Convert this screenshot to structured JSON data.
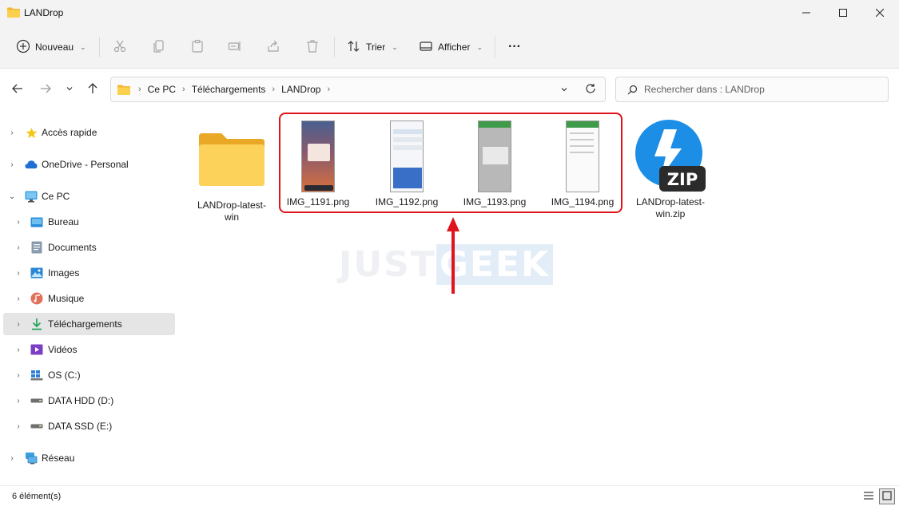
{
  "window": {
    "title": "LANDrop"
  },
  "toolbar": {
    "new_label": "Nouveau",
    "sort_label": "Trier",
    "view_label": "Afficher",
    "more_label": "···"
  },
  "address": {
    "crumbs": [
      "Ce PC",
      "Téléchargements",
      "LANDrop"
    ],
    "search_placeholder": "Rechercher dans : LANDrop"
  },
  "sidebar": {
    "items": [
      {
        "label": "Accès rapide",
        "icon": "star-icon"
      },
      {
        "label": "OneDrive - Personal",
        "icon": "cloud-icon"
      },
      {
        "label": "Ce PC",
        "icon": "monitor-icon"
      },
      {
        "label": "Bureau",
        "icon": "desktop-icon"
      },
      {
        "label": "Documents",
        "icon": "document-icon"
      },
      {
        "label": "Images",
        "icon": "image-icon"
      },
      {
        "label": "Musique",
        "icon": "music-icon"
      },
      {
        "label": "Téléchargements",
        "icon": "download-icon"
      },
      {
        "label": "Vidéos",
        "icon": "video-icon"
      },
      {
        "label": "OS (C:)",
        "icon": "windows-drive-icon"
      },
      {
        "label": "DATA HDD (D:)",
        "icon": "drive-icon"
      },
      {
        "label": "DATA SSD (E:)",
        "icon": "drive-icon"
      },
      {
        "label": "Réseau",
        "icon": "network-icon"
      }
    ]
  },
  "files": [
    {
      "name": "LANDrop-latest-win",
      "icon": "folder-icon"
    },
    {
      "name": "IMG_1191.png",
      "icon": "image-thumbnail"
    },
    {
      "name": "IMG_1192.png",
      "icon": "image-thumbnail"
    },
    {
      "name": "IMG_1193.png",
      "icon": "image-thumbnail"
    },
    {
      "name": "IMG_1194.png",
      "icon": "image-thumbnail"
    },
    {
      "name": "LANDrop-latest-win.zip",
      "icon": "zip-icon"
    }
  ],
  "watermark": {
    "part1": "JUST",
    "part2": "GEEK"
  },
  "zip_badge": "ZIP",
  "status": {
    "count": "6 élément(s)"
  },
  "colors": {
    "highlight": "#e0141c",
    "selected_nav": "#e5e5e5",
    "folder": "#f8c846",
    "accent": "#0078d4"
  }
}
